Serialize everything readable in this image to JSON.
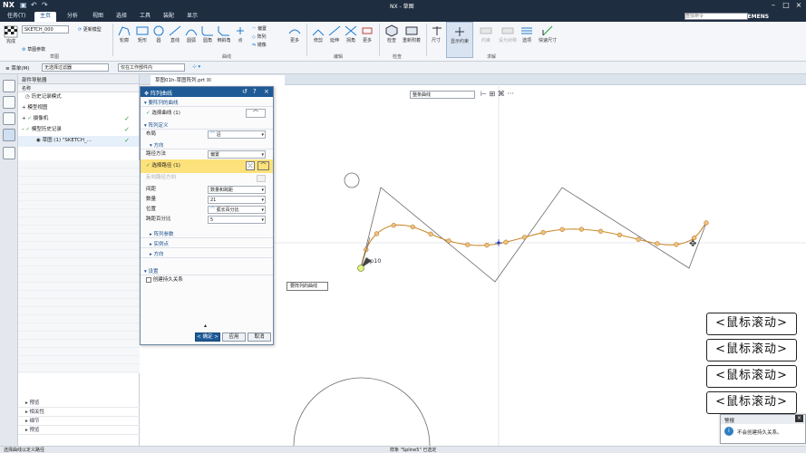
{
  "app": {
    "logo": "NX",
    "title": "NX - 草图",
    "brand": "SIEMENS",
    "search_placeholder": "查找命令"
  },
  "menu": {
    "tabs": [
      "任务(T)",
      "主页",
      "分析",
      "视图",
      "选择",
      "工具",
      "装配",
      "显示"
    ],
    "active_index": 1
  },
  "ribbon": {
    "sketch_name": "SKETCH_000",
    "left_buttons": [
      "完成",
      "更新模型",
      "草图参数"
    ],
    "draw_tools": [
      "轮廓",
      "矩形",
      "圆",
      "直线",
      "圆弧",
      "圆角",
      "倒斜角",
      "点"
    ],
    "mid_tools": [
      "偏置",
      "阵列",
      "镜像",
      "更多"
    ],
    "edit_tools": [
      "修剪",
      "延伸",
      "拐角",
      "更多"
    ],
    "tools2": [
      "检查",
      "重新附着",
      "显示约束"
    ],
    "right_tools": [
      "尺寸",
      "约束",
      "设为对称",
      "选项",
      "快速尺寸"
    ],
    "groups": [
      "草图",
      "曲线",
      "编辑",
      "检查",
      "求解"
    ]
  },
  "subbar": {
    "menu_label": "菜单(M)",
    "filter": "无选择过滤器",
    "scope": "仅在工作部件内"
  },
  "navigator": {
    "title": "部件导航器",
    "col_name": "名称",
    "items": [
      {
        "label": "历史记录模式",
        "indent": 1,
        "check": false
      },
      {
        "label": "模型视图",
        "indent": 1,
        "check": false
      },
      {
        "label": "摄像机",
        "indent": 1,
        "check": true
      },
      {
        "label": "模型历史记录",
        "indent": 1,
        "check": true
      },
      {
        "label": "草图 (1) \"SKETCH_...",
        "indent": 2,
        "check": true
      }
    ],
    "bottom": [
      "预览",
      "相关性",
      "细节",
      "预览"
    ]
  },
  "doc_tab": "草图01h-草图阵列.prt ☒",
  "dialog": {
    "title": "阵列曲线",
    "sec_select": "要阵列的曲线",
    "select_curve": "选择曲线 (1)",
    "sec_define": "阵列定义",
    "layout_label": "布局",
    "layout_value": "沿",
    "sec_direction": "方向",
    "path_method_label": "路径方法",
    "path_method_value": "偏置",
    "select_path": "选择路径 (1)",
    "reverse_dir": "反向路径方向",
    "spacing_label": "间距",
    "spacing_value": "数量和跨距",
    "count_label": "数量",
    "count_value": "21",
    "position_label": "位置",
    "position_value": "弧长百分比",
    "span_label": "跨距百分比",
    "span_value": "5",
    "sec_params": "阵列参数",
    "sec_instances": "实例点",
    "sec_orient": "方向",
    "sec_settings": "设置",
    "create_assoc": "创建持久关系",
    "ok": "< 确定 >",
    "apply": "应用",
    "cancel": "取消"
  },
  "viewport": {
    "select_filter": "整条曲线",
    "dim_label": "p10",
    "tag": "要阵列的曲线",
    "axis_x": "X",
    "axis_y": "Y",
    "hints": [
      "<鼠标滚动>",
      "<鼠标滚动>",
      "<鼠标滚动>",
      "<鼠标滚动>"
    ]
  },
  "alert": {
    "title": "警报",
    "message": "不会创建持久关系。"
  },
  "status": {
    "left": "选择曲线以定义路径",
    "center": "样条 \"Spline5\" 已选定"
  },
  "colors": {
    "title_bg": "#1f2d40",
    "accent": "#1e5a96",
    "highlight": "#fde17a",
    "curve": "#d08a2a"
  }
}
